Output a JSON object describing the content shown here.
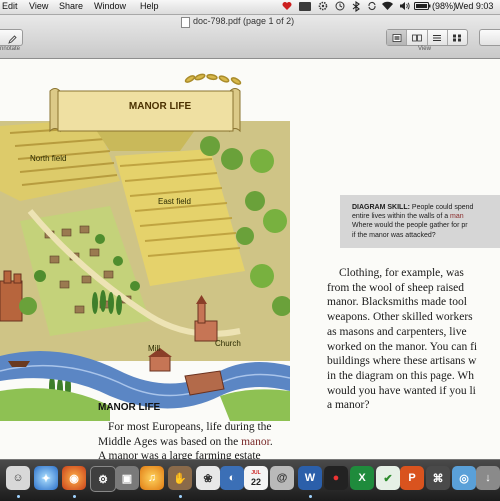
{
  "menubar": {
    "items": [
      "Edit",
      "View",
      "Share",
      "Window",
      "Help"
    ],
    "battery_percent": "(98%)",
    "clock": "Wed 9:03"
  },
  "window": {
    "title": "doc-798.pdf (page 1 of 2)",
    "annotate_label": "nnotate",
    "view_label": "View"
  },
  "illustration": {
    "banner_title": "MANOR LIFE",
    "labels": {
      "north_field": "North field",
      "east_field": "East field",
      "mill": "Mill",
      "church": "Church"
    }
  },
  "diagram_skill": {
    "label": "DIAGRAM SKILL:",
    "lines": [
      " People could spend",
      "entire lives within the walls of a ",
      "Where would the people gather for pr",
      "if the manor was attacked?"
    ],
    "emphasis_word": "man"
  },
  "right_column": {
    "lines": [
      "Clothing, for example, was",
      "from the wool of sheep raised",
      "manor. Blacksmiths made tool",
      "weapons. Other skilled workers",
      "as masons and carpenters, live",
      "worked on the manor. You can fi",
      "buildings where these artisans w",
      "in the diagram on this page. Wh",
      "would you have wanted if you li",
      "a manor?"
    ]
  },
  "left_column": {
    "heading": "MANOR LIFE",
    "line1": "For most Europeans, life during the",
    "line2_start": "Middle Ages was based on the ",
    "line2_term": "manor",
    "line2_end": ".",
    "line3": "A manor was a large farming estate"
  },
  "dock": {
    "calendar_day": "22",
    "calendar_month": "JUL"
  },
  "colors": {
    "field_yellow": "#e3cf63",
    "grass_green": "#78b13f",
    "river_blue": "#5b86c4",
    "banner_cream": "#efe0a2",
    "highlight_gray": "#d6d6d6"
  }
}
